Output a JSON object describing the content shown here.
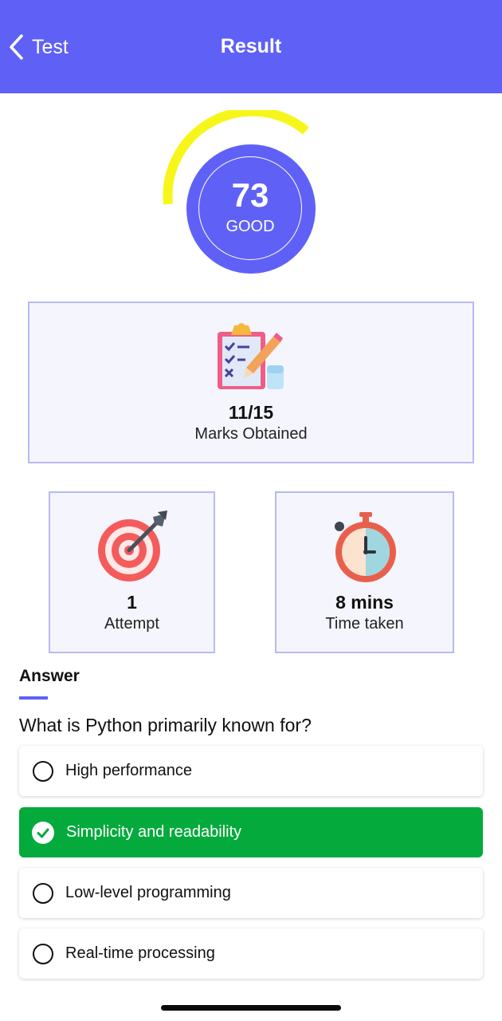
{
  "header": {
    "back_label": "Test",
    "title": "Result",
    "color": "#5f61f6"
  },
  "score": {
    "value": "73",
    "label": "GOOD",
    "gauge_color": "#f7f61a"
  },
  "marks": {
    "icon": "clipboard-checklist-icon",
    "value": "11/15",
    "label": "Marks Obtained"
  },
  "attempt": {
    "icon": "target-dart-icon",
    "value": "1",
    "label": "Attempt"
  },
  "time": {
    "icon": "stopwatch-icon",
    "value": "8 mins",
    "label": "Time taken"
  },
  "answer": {
    "heading": "Answer",
    "question": "What is Python primarily known for?",
    "options": [
      {
        "text": "High performance",
        "selected": false
      },
      {
        "text": "Simplicity and readability",
        "selected": true
      },
      {
        "text": "Low-level programming",
        "selected": false
      },
      {
        "text": "Real-time processing",
        "selected": false
      }
    ],
    "correct_color": "#05aa3c"
  }
}
